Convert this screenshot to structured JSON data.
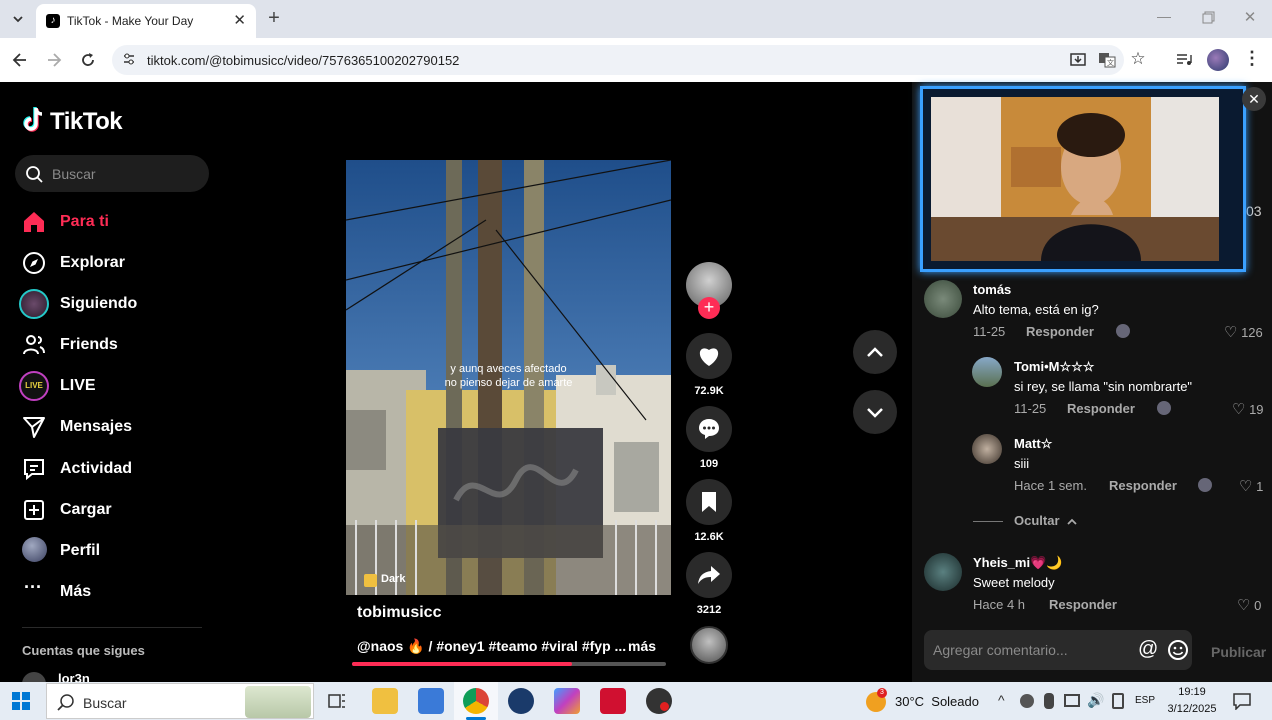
{
  "browser": {
    "tab_title": "TikTok - Make Your Day",
    "url": "tiktok.com/@tobimusicc/video/7576365100202790152"
  },
  "sidebar": {
    "logo": "TikTok",
    "search_placeholder": "Buscar",
    "items": [
      {
        "label": "Para ti",
        "active": true
      },
      {
        "label": "Explorar"
      },
      {
        "label": "Siguiendo"
      },
      {
        "label": "Friends"
      },
      {
        "label": "LIVE"
      },
      {
        "label": "Mensajes"
      },
      {
        "label": "Actividad"
      },
      {
        "label": "Cargar"
      },
      {
        "label": "Perfil"
      },
      {
        "label": "Más"
      }
    ],
    "following_heading": "Cuentas que sigues",
    "following_first": "lor3n"
  },
  "video": {
    "caption_line1": "y aunq aveces afectado",
    "caption_line2": "no pienso dejar de amarte",
    "tag": "Dark",
    "author": "tobimusicc",
    "description": "@naos 🔥 / #oney1 #teamo #viral #fyp ...",
    "more": "más",
    "likes": "72.9K",
    "comments": "109",
    "saves": "12.6K",
    "shares": "3212",
    "progress": 0.7
  },
  "comments": {
    "partial_count": "03",
    "list": [
      {
        "name": "tomás",
        "text": "Alto tema, está en ig?",
        "date": "11-25",
        "reply": "Responder",
        "likes": "126"
      },
      {
        "name": "Tomi•M☆☆☆",
        "text": "si rey, se llama \"sin nombrarte\"",
        "date": "11-25",
        "reply": "Responder",
        "likes": "19"
      },
      {
        "name": "Matt☆",
        "text": "siii",
        "date": "Hace 1 sem.",
        "reply": "Responder",
        "likes": "1"
      },
      {
        "name": "Yheis_mi💗🌙",
        "text": "Sweet melody",
        "date": "Hace 4 h",
        "reply": "Responder",
        "likes": "0"
      }
    ],
    "hide_label": "Ocultar",
    "input_placeholder": "Agregar comentario...",
    "publish": "Publicar"
  },
  "taskbar": {
    "search_placeholder": "Buscar",
    "weather": "30°C  Soleado",
    "weather_badge": "3",
    "language": "ESP",
    "time": "19:19",
    "date": "3/12/2025"
  },
  "colors": {
    "accent": "#fe2c55",
    "page_bg": "#000000",
    "panel_bg": "#121212",
    "overlay_border": "#3aa0ff"
  }
}
